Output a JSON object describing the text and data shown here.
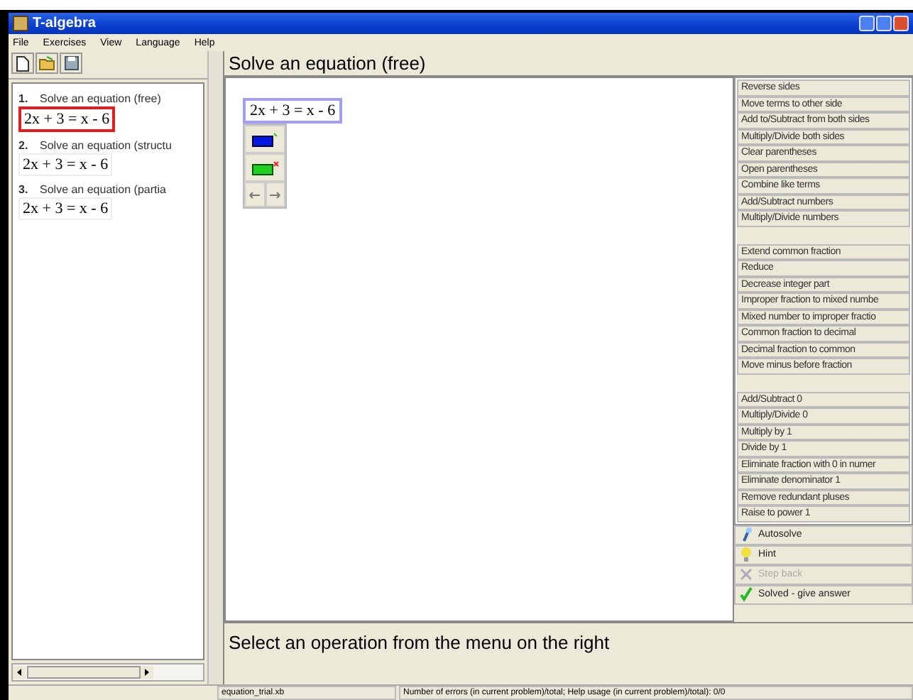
{
  "window": {
    "title": "T-algebra"
  },
  "menu": [
    "File",
    "Exercises",
    "View",
    "Language",
    "Help"
  ],
  "problems": [
    {
      "number": "1.",
      "title": "Solve an equation (free)",
      "equation": "2x + 3 = x - 6",
      "selected": true
    },
    {
      "number": "2.",
      "title": "Solve an equation (structu",
      "equation": "2x + 3 = x - 6",
      "selected": false
    },
    {
      "number": "3.",
      "title": "Solve an equation (partia",
      "equation": "2x + 3 = x - 6",
      "selected": false
    }
  ],
  "header": "Solve an equation (free)",
  "work_equation": "2x + 3 = x - 6",
  "operations": [
    {
      "kind": "op",
      "label": "Reverse sides"
    },
    {
      "kind": "op",
      "label": "Move terms to other side"
    },
    {
      "kind": "op",
      "label": "Add to/Subtract from both sides"
    },
    {
      "kind": "op",
      "label": "Multiply/Divide both sides"
    },
    {
      "kind": "op",
      "label": "Clear parentheses"
    },
    {
      "kind": "op",
      "label": "Open parentheses"
    },
    {
      "kind": "op",
      "label": "Combine like terms"
    },
    {
      "kind": "op",
      "label": "Add/Subtract numbers"
    },
    {
      "kind": "op",
      "label": "Multiply/Divide numbers"
    },
    {
      "kind": "gap"
    },
    {
      "kind": "op",
      "label": "Extend common fraction"
    },
    {
      "kind": "op",
      "label": "Reduce"
    },
    {
      "kind": "op",
      "label": "Decrease integer part"
    },
    {
      "kind": "op",
      "label": "Improper fraction to mixed numbe"
    },
    {
      "kind": "op",
      "label": "Mixed number to improper fractio"
    },
    {
      "kind": "op",
      "label": "Common fraction to decimal"
    },
    {
      "kind": "op",
      "label": "Decimal fraction to common"
    },
    {
      "kind": "op",
      "label": "Move minus before fraction"
    },
    {
      "kind": "gap"
    },
    {
      "kind": "op",
      "label": "Add/Subtract 0"
    },
    {
      "kind": "op",
      "label": "Multiply/Divide 0"
    },
    {
      "kind": "op",
      "label": "Multiply by 1"
    },
    {
      "kind": "op",
      "label": "Divide by 1"
    },
    {
      "kind": "op",
      "label": "Eliminate fraction with 0 in numer"
    },
    {
      "kind": "op",
      "label": "Eliminate denominator 1"
    },
    {
      "kind": "op",
      "label": "Remove redundant pluses"
    },
    {
      "kind": "op",
      "label": "Raise to power 1"
    }
  ],
  "actions": [
    {
      "kind": "autosolve",
      "label": "Autosolve",
      "disabled": false
    },
    {
      "kind": "hint",
      "label": "Hint",
      "disabled": false
    },
    {
      "kind": "stepback",
      "label": "Step back",
      "disabled": true
    },
    {
      "kind": "solved",
      "label": "Solved - give answer",
      "disabled": false
    }
  ],
  "message": "Select an operation from the menu on the right",
  "status_bar": [
    "equation_trial.xb",
    "Number of errors (in current problem)/total; Help usage (in current problem)/total): 0/0"
  ]
}
